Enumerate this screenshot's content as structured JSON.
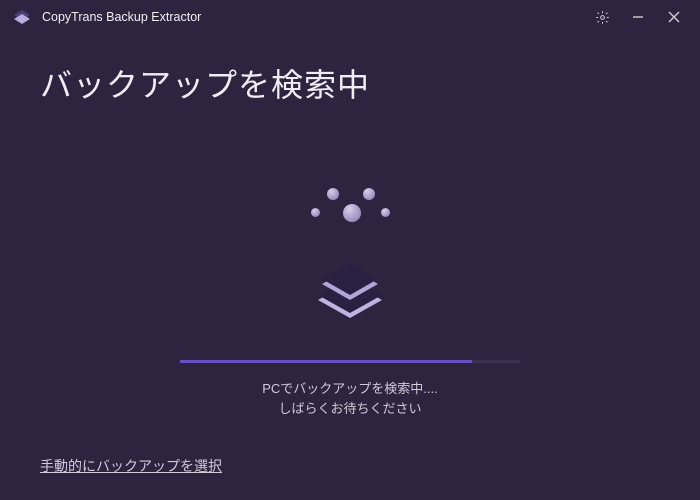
{
  "titlebar": {
    "app_name": "CopyTrans Backup Extractor"
  },
  "heading": "バックアップを検索中",
  "status": {
    "line1": "PCでバックアップを検索中....",
    "line2": "しばらくお待ちください"
  },
  "progress": {
    "percent": 86
  },
  "footer": {
    "manual_select": "手動的にバックアップを選択"
  },
  "icons": {
    "app": "app-logo-icon",
    "settings": "gear-icon",
    "minimize": "minimize-icon",
    "close": "close-icon"
  },
  "colors": {
    "background": "#2e2440",
    "accent": "#6a4fc4",
    "text": "#e5e5e5"
  }
}
